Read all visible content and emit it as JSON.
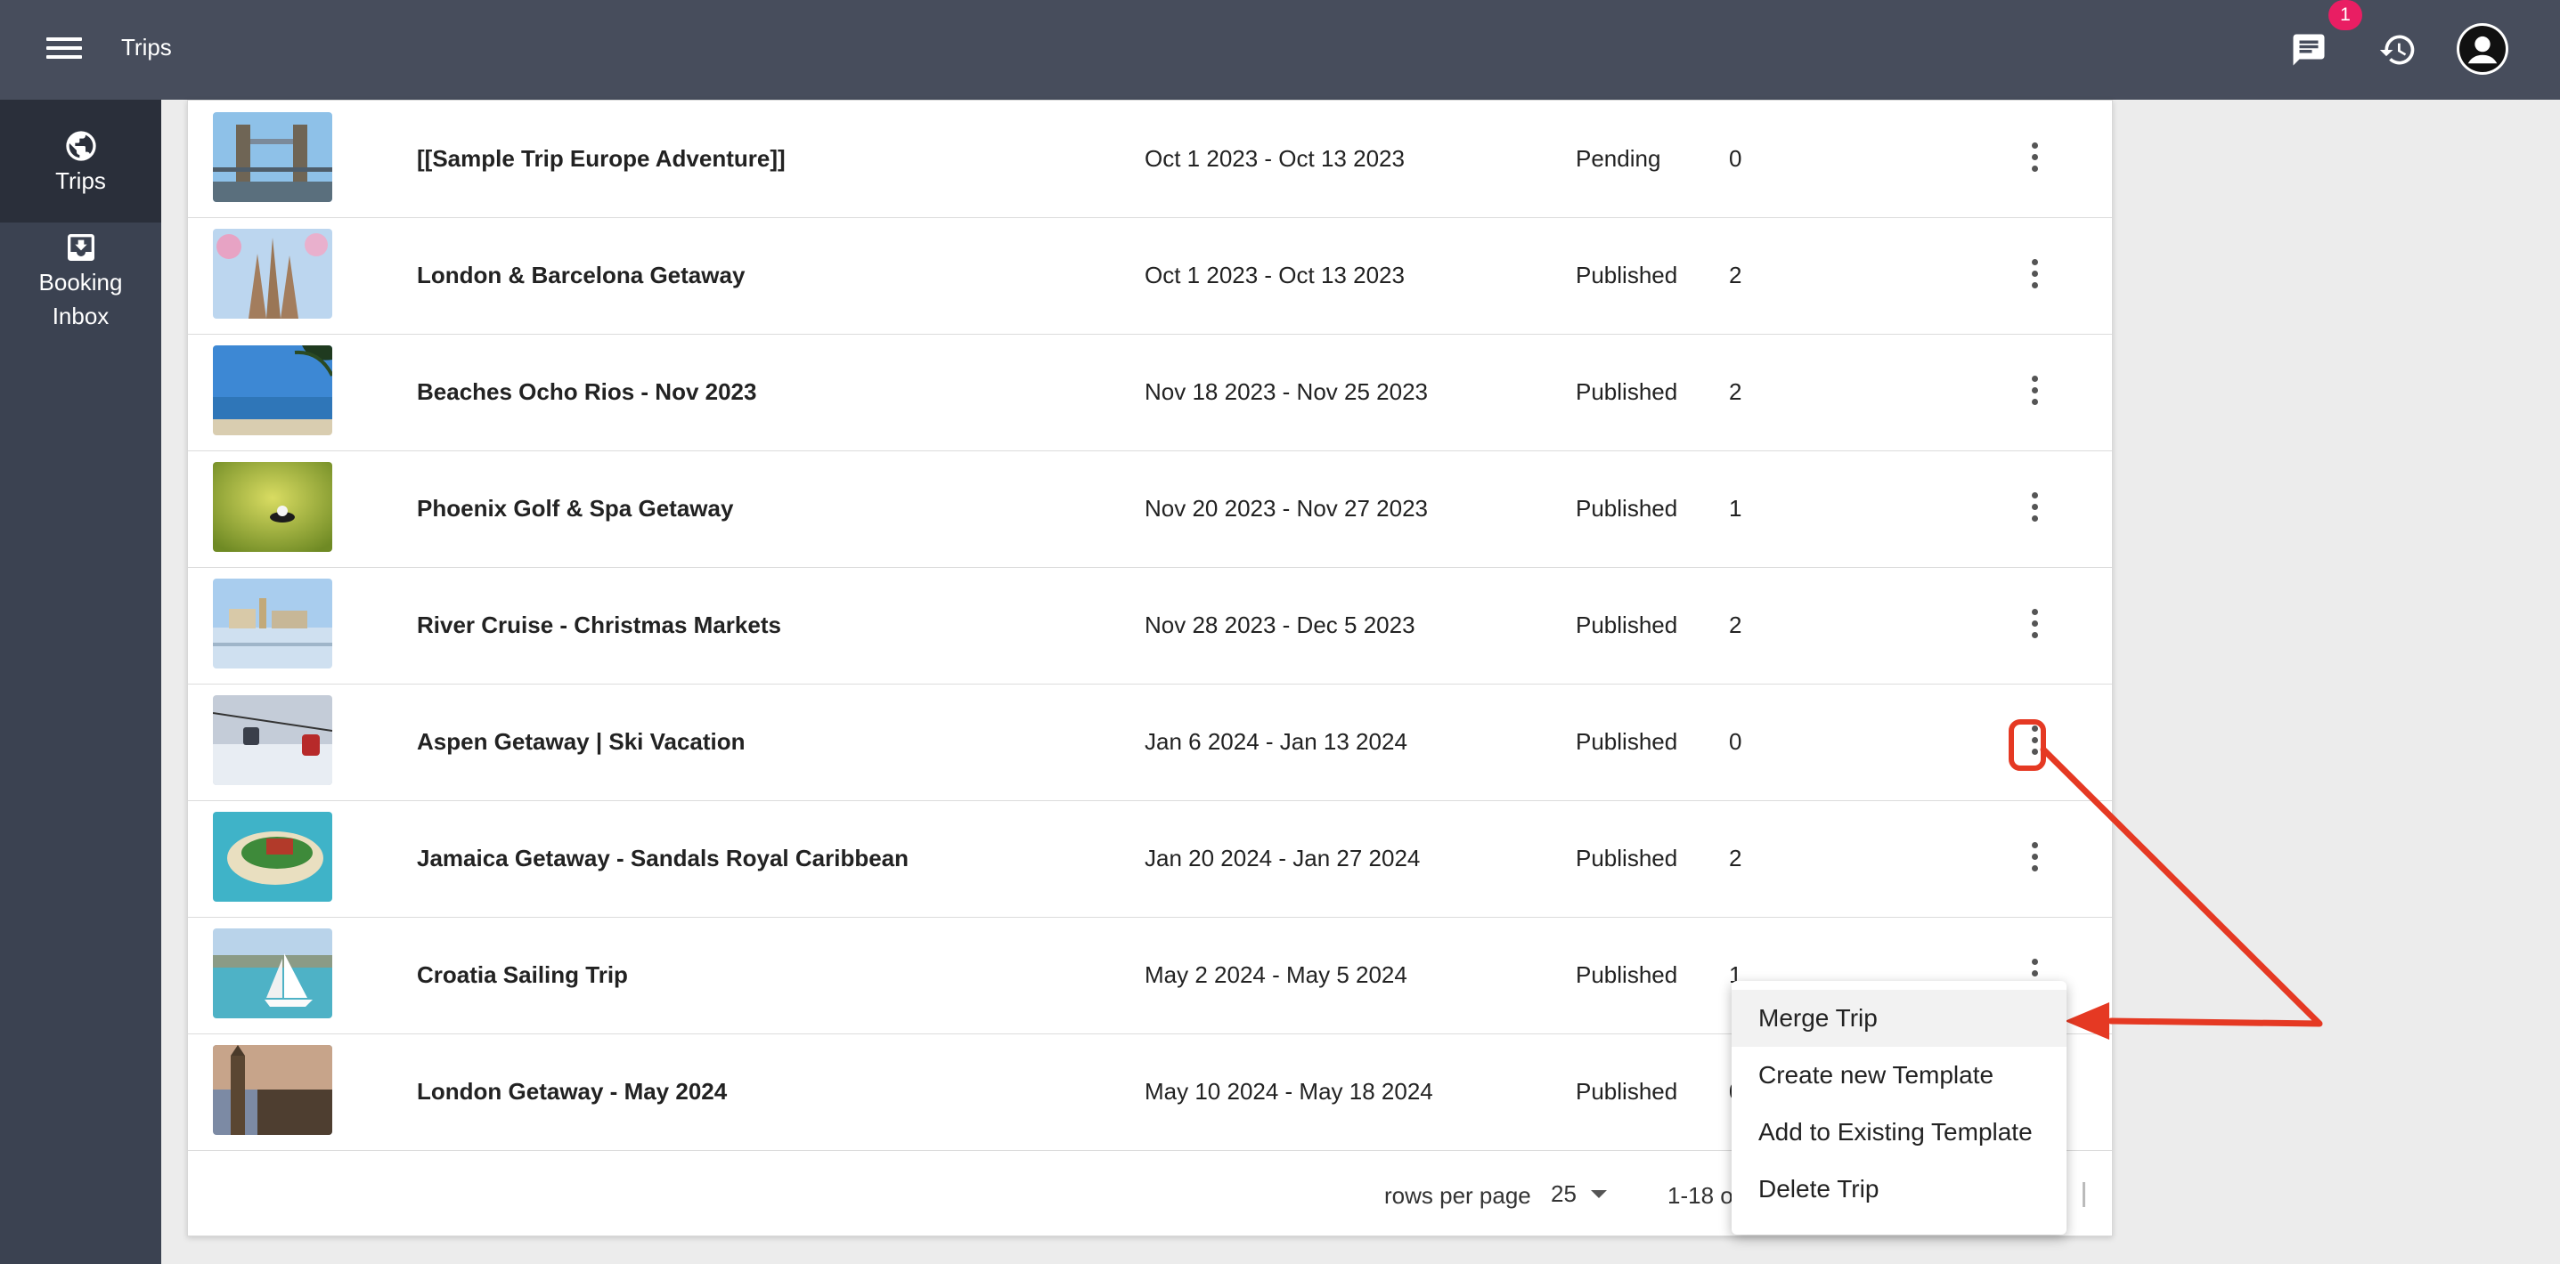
{
  "header": {
    "title": "Trips",
    "notification_count": "1",
    "icons": [
      "menu-icon",
      "chat-icon",
      "history-icon",
      "account-icon"
    ]
  },
  "sidebar": {
    "items": [
      {
        "label": "Trips",
        "icon": "globe-icon",
        "active": true
      },
      {
        "label_line1": "Booking",
        "label_line2": "Inbox",
        "icon": "inbox-download-icon",
        "active": false
      }
    ]
  },
  "trips": [
    {
      "name": "[[Sample Trip Europe Adventure]]",
      "dates": "Oct 1 2023 - Oct 13 2023",
      "status": "Pending",
      "count": "0",
      "image": "tower-bridge"
    },
    {
      "name": "London & Barcelona Getaway",
      "dates": "Oct 1 2023 - Oct 13 2023",
      "status": "Published",
      "count": "2",
      "image": "sagrada-familia"
    },
    {
      "name": "Beaches Ocho Rios - Nov 2023",
      "dates": "Nov 18 2023 - Nov 25 2023",
      "status": "Published",
      "count": "2",
      "image": "beach"
    },
    {
      "name": "Phoenix Golf & Spa Getaway",
      "dates": "Nov 20 2023 - Nov 27 2023",
      "status": "Published",
      "count": "1",
      "image": "golf"
    },
    {
      "name": "River Cruise - Christmas Markets",
      "dates": "Nov 28 2023 - Dec 5 2023",
      "status": "Published",
      "count": "2",
      "image": "river-town"
    },
    {
      "name": "Aspen Getaway | Ski Vacation",
      "dates": "Jan 6 2024 - Jan 13 2024",
      "status": "Published",
      "count": "0",
      "image": "ski-gondola"
    },
    {
      "name": "Jamaica Getaway - Sandals Royal Caribbean",
      "dates": "Jan 20 2024 - Jan 27 2024",
      "status": "Published",
      "count": "2",
      "image": "resort-island"
    },
    {
      "name": "Croatia Sailing Trip",
      "dates": "May 2 2024 - May 5 2024",
      "status": "Published",
      "count": "1",
      "image": "sailboat"
    },
    {
      "name": "London Getaway - May 2024",
      "dates": "May 10 2024 - May 18 2024",
      "status": "Published",
      "count": "0",
      "image": "big-ben"
    }
  ],
  "footer": {
    "rows_per_page_label": "rows per page",
    "rows_per_page_value": "25",
    "page_range": "1-18 of"
  },
  "context_menu": {
    "items": [
      "Merge Trip",
      "Create new Template",
      "Add to Existing Template",
      "Delete Trip"
    ],
    "hovered": "Merge Trip"
  },
  "colors": {
    "header": "#474d5c",
    "sidebar": "#3b4251",
    "annotation": "#e53923",
    "badge": "#e91e63"
  }
}
